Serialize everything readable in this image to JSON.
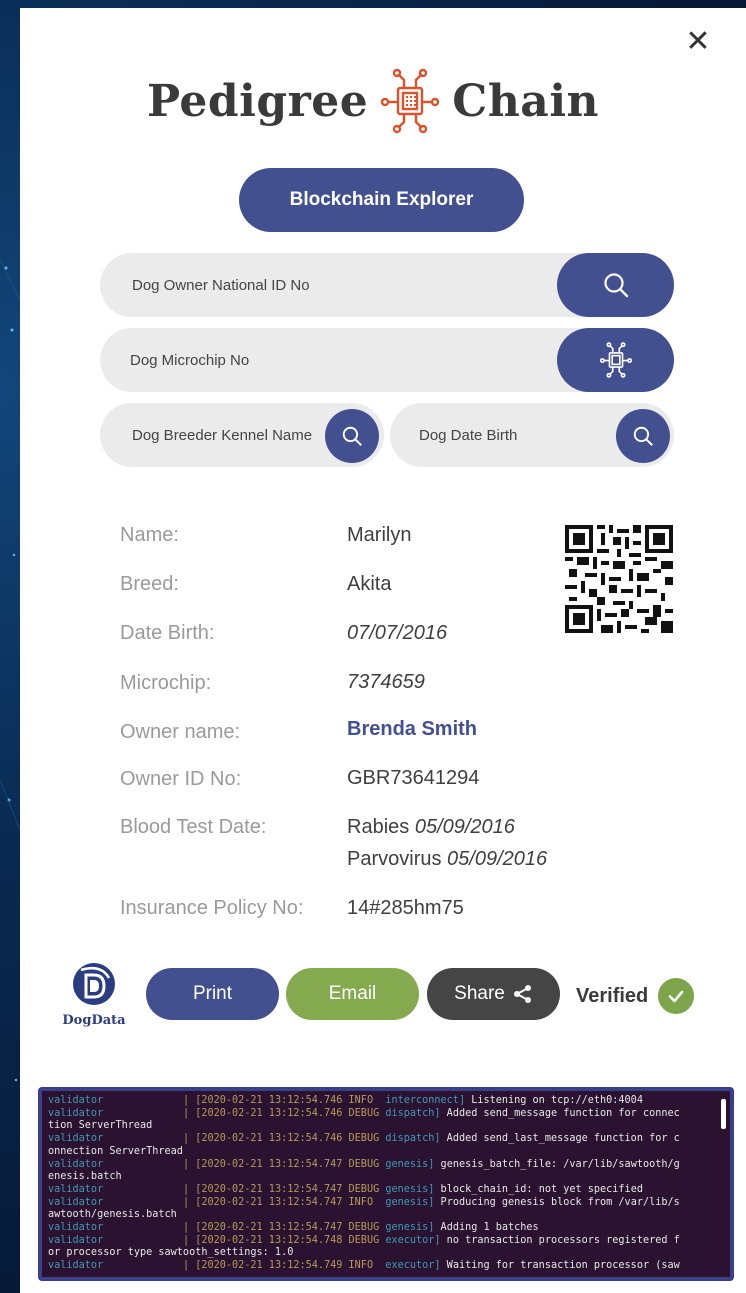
{
  "brand": {
    "left": "Pedigree",
    "right": "Chain"
  },
  "actions": {
    "explorer_label": "Blockchain Explorer"
  },
  "search": {
    "owner_id_placeholder": "Dog Owner National ID No",
    "microchip_placeholder": "Dog Microchip No",
    "kennel_placeholder": "Dog Breeder Kennel Name",
    "birth_placeholder": "Dog Date Birth"
  },
  "record": {
    "name_label": "Name:",
    "name": "Marilyn",
    "breed_label": "Breed:",
    "breed": "Akita",
    "birth_label": "Date Birth:",
    "birth": "07/07/2016",
    "chip_label": "Microchip:",
    "chip": "7374659",
    "owner_label": "Owner name:",
    "owner": "Brenda Smith",
    "owner_id_label": "Owner ID No:",
    "owner_id": "GBR73641294",
    "blood_label": "Blood Test Date:",
    "rabies": "Rabies",
    "rabies_date": "05/09/2016",
    "parvo": "Parvovirus",
    "parvo_date": "05/09/2016",
    "insurance_label": "Insurance Policy No:",
    "insurance": "14#285hm75"
  },
  "footer": {
    "logo_text": "DogData",
    "print_label": "Print",
    "email_label": "Email",
    "share_label": "Share",
    "verified_label": "Verified"
  },
  "colors": {
    "primary": "#43508f",
    "email": "#85a94f",
    "share": "#454545",
    "verified": "#7ca54c",
    "accent": "#d9532c"
  },
  "icons": [
    "close-icon",
    "chip-icon",
    "search-icon",
    "qr-code-icon",
    "share-icon",
    "check-icon",
    "dogdata-logo-icon"
  ],
  "terminal": {
    "lines": [
      {
        "src": "validator",
        "ts": "| [2020-02-21 13:12:54.746 INFO",
        "mod": "interconnect]",
        "msg": " Listening on tcp://eth0:4004"
      },
      {
        "src": "validator",
        "ts": "| [2020-02-21 13:12:54.746 DEBUG",
        "mod": "dispatch]",
        "msg": " Added send_message function for connec"
      },
      {
        "src": "",
        "ts": "",
        "mod": "",
        "msg": "tion ServerThread"
      },
      {
        "src": "validator",
        "ts": "| [2020-02-21 13:12:54.746 DEBUG",
        "mod": "dispatch]",
        "msg": " Added send_last_message function for c"
      },
      {
        "src": "",
        "ts": "",
        "mod": "",
        "msg": "onnection ServerThread"
      },
      {
        "src": "validator",
        "ts": "| [2020-02-21 13:12:54.747 DEBUG",
        "mod": "genesis]",
        "msg": " genesis_batch_file: /var/lib/sawtooth/g"
      },
      {
        "src": "",
        "ts": "",
        "mod": "",
        "msg": "enesis.batch"
      },
      {
        "src": "validator",
        "ts": "| [2020-02-21 13:12:54.747 DEBUG",
        "mod": "genesis]",
        "msg": " block_chain_id: not yet specified"
      },
      {
        "src": "validator",
        "ts": "| [2020-02-21 13:12:54.747 INFO",
        "mod": "genesis]",
        "msg": " Producing genesis block from /var/lib/s"
      },
      {
        "src": "",
        "ts": "",
        "mod": "",
        "msg": "awtooth/genesis.batch"
      },
      {
        "src": "validator",
        "ts": "| [2020-02-21 13:12:54.747 DEBUG",
        "mod": "genesis]",
        "msg": " Adding 1 batches"
      },
      {
        "src": "validator",
        "ts": "| [2020-02-21 13:12:54.748 DEBUG",
        "mod": "executor]",
        "msg": " no transaction processors registered f"
      },
      {
        "src": "",
        "ts": "",
        "mod": "",
        "msg": "or processor type sawtooth_settings: 1.0"
      },
      {
        "src": "validator",
        "ts": "| [2020-02-21 13:12:54.749 INFO",
        "mod": "executor]",
        "msg": " Waiting for transaction processor (saw"
      }
    ]
  }
}
